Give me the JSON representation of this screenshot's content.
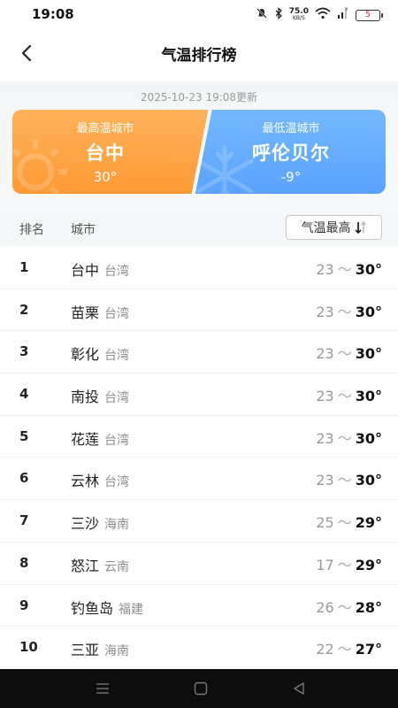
{
  "status_bar": {
    "time": "19:08",
    "net_speed_value": "75.0",
    "net_speed_unit": "KB/S",
    "battery_level": "5"
  },
  "header": {
    "title": "气温排行榜",
    "back_icon": "chevron-left-icon"
  },
  "update_time": "2025-10-23 19:08更新",
  "extremes": {
    "highest": {
      "label": "最高温城市",
      "city": "台中",
      "temp": "30°",
      "color": "#ff9a35"
    },
    "lowest": {
      "label": "最低温城市",
      "city": "呼伦贝尔",
      "temp": "-9°",
      "color": "#5aa2ff"
    }
  },
  "table": {
    "col_rank": "排名",
    "col_city": "城市",
    "sort_label": "气温最高",
    "sort_icon": "sort-arrows-icon",
    "rows": [
      {
        "rank": "1",
        "city": "台中",
        "province": "台湾",
        "low": "23",
        "sep": "～",
        "high": "30°"
      },
      {
        "rank": "2",
        "city": "苗栗",
        "province": "台湾",
        "low": "23",
        "sep": "～",
        "high": "30°"
      },
      {
        "rank": "3",
        "city": "彰化",
        "province": "台湾",
        "low": "23",
        "sep": "～",
        "high": "30°"
      },
      {
        "rank": "4",
        "city": "南投",
        "province": "台湾",
        "low": "23",
        "sep": "～",
        "high": "30°"
      },
      {
        "rank": "5",
        "city": "花莲",
        "province": "台湾",
        "low": "23",
        "sep": "～",
        "high": "30°"
      },
      {
        "rank": "6",
        "city": "云林",
        "province": "台湾",
        "low": "23",
        "sep": "～",
        "high": "30°"
      },
      {
        "rank": "7",
        "city": "三沙",
        "province": "海南",
        "low": "25",
        "sep": "～",
        "high": "29°"
      },
      {
        "rank": "8",
        "city": "怒江",
        "province": "云南",
        "low": "17",
        "sep": "～",
        "high": "29°"
      },
      {
        "rank": "9",
        "city": "钓鱼岛",
        "province": "福建",
        "low": "26",
        "sep": "～",
        "high": "28°"
      },
      {
        "rank": "10",
        "city": "三亚",
        "province": "海南",
        "low": "22",
        "sep": "～",
        "high": "27°"
      }
    ]
  },
  "system_nav": {
    "menu_icon": "menu-lines-icon",
    "home_icon": "home-square-icon",
    "back_icon": "back-triangle-icon"
  }
}
